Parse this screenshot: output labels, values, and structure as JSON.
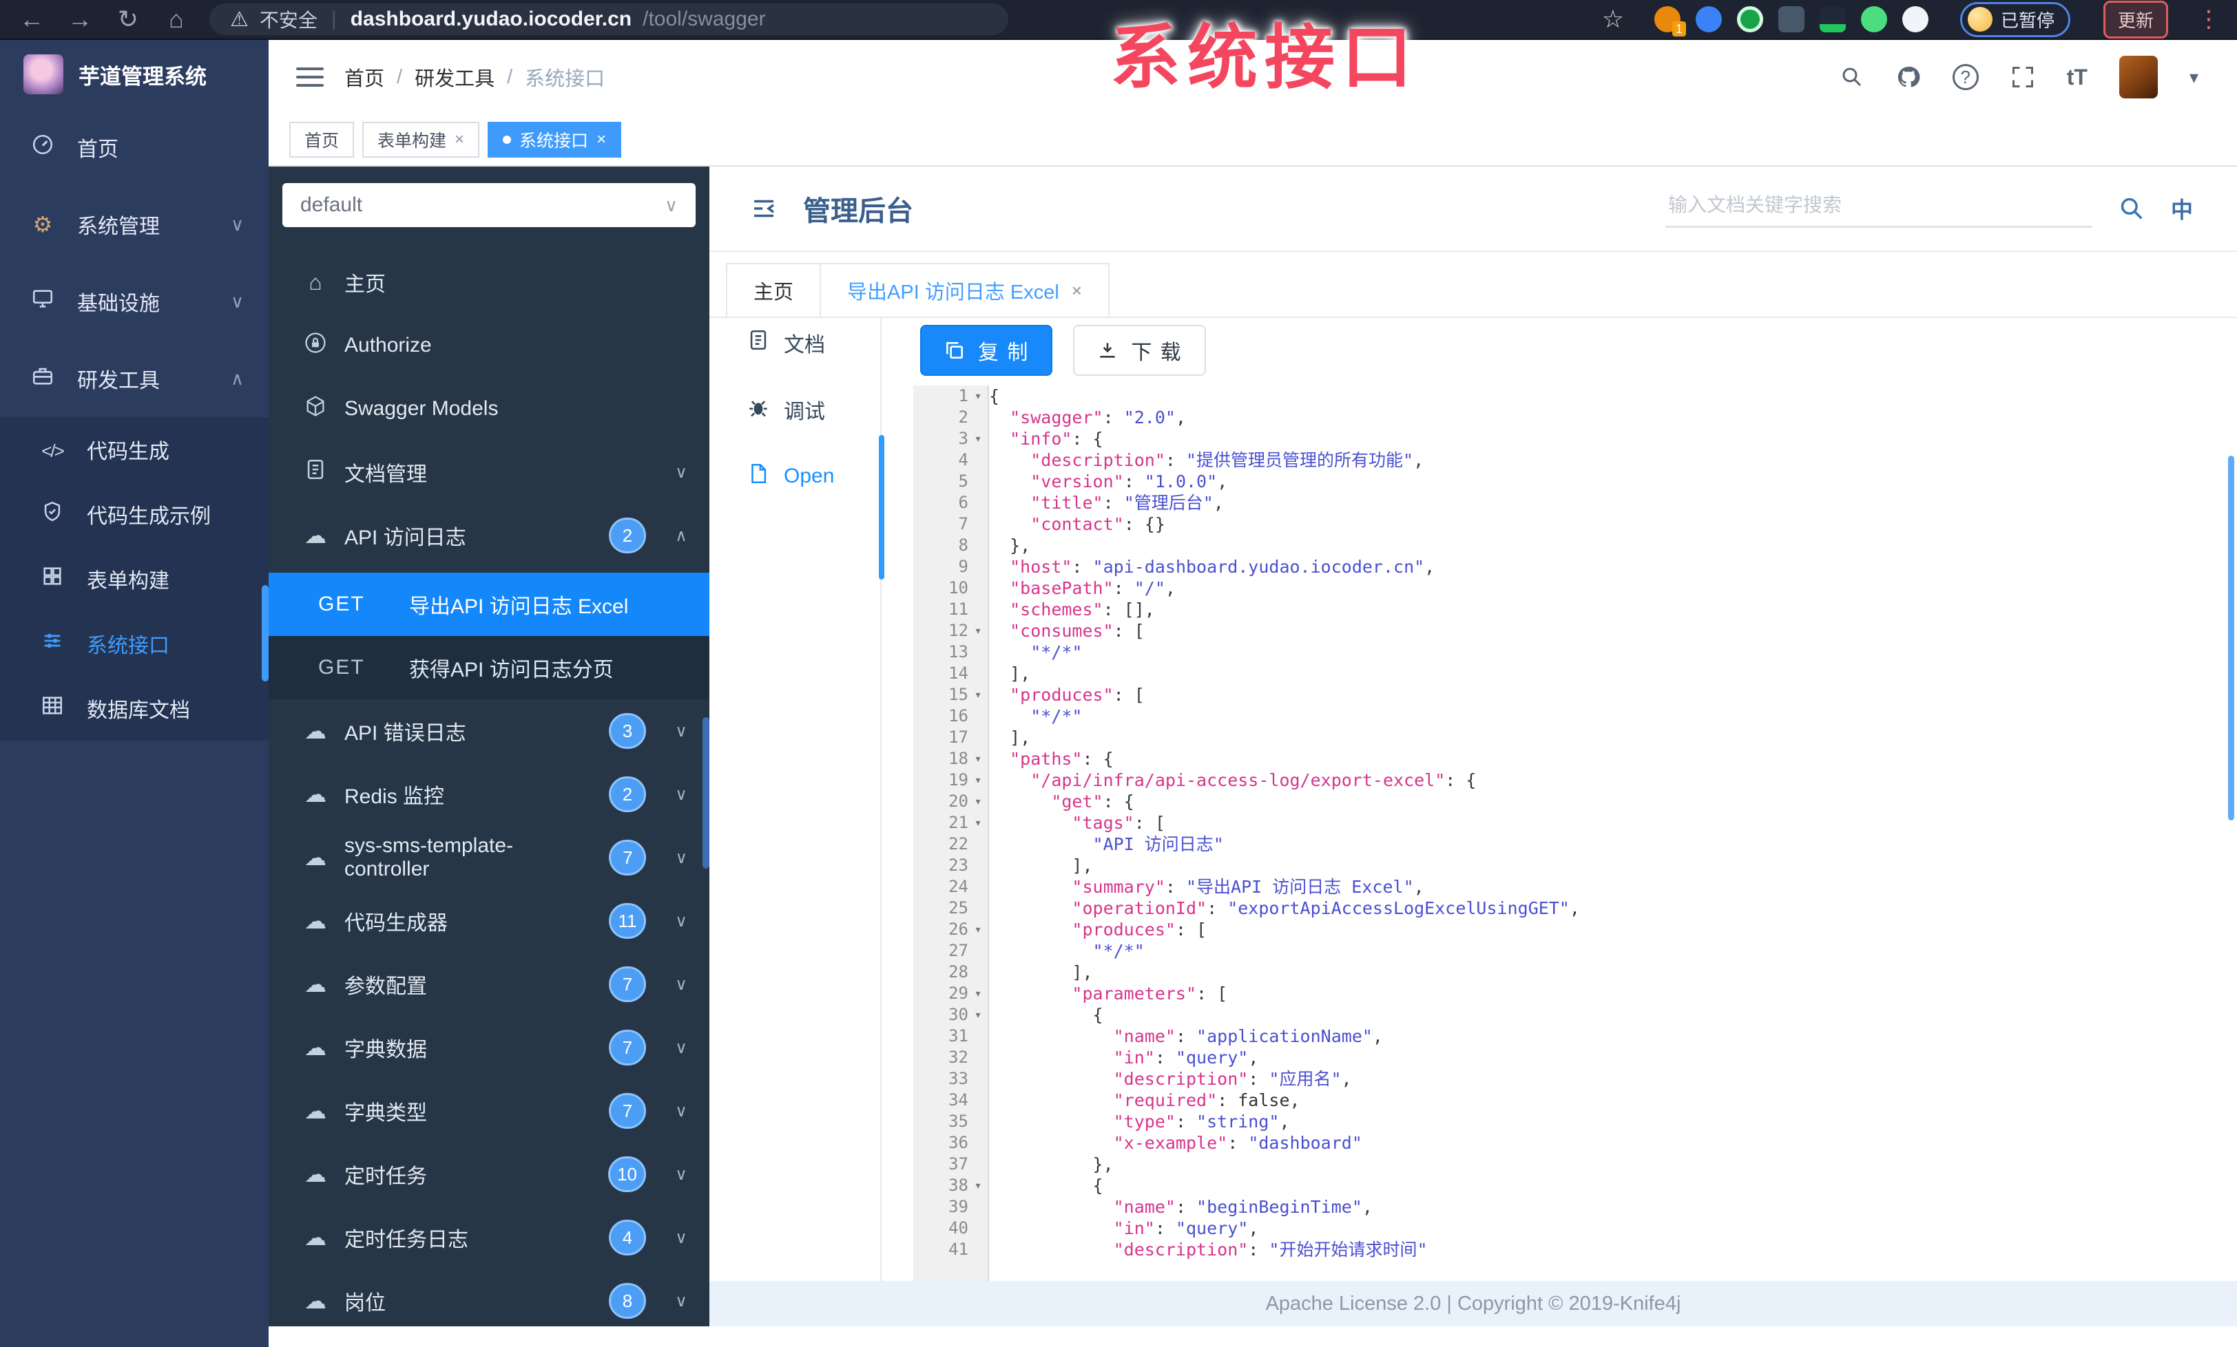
{
  "annotation": "系统接口",
  "browser": {
    "security": "不安全",
    "host": "dashboard.yudao.iocoder.cn",
    "path": "/tool/swagger",
    "ext_badge": "1",
    "paused": "已暂停",
    "update": "更新"
  },
  "app": {
    "title": "芋道管理系统"
  },
  "sidebar": {
    "main": [
      {
        "label": "首页",
        "icon": "gauge-icon",
        "chevron": ""
      },
      {
        "label": "系统管理",
        "icon": "gear-icon",
        "chevron": "down"
      },
      {
        "label": "基础设施",
        "icon": "infra-icon",
        "chevron": "down"
      },
      {
        "label": "研发工具",
        "icon": "tools-icon",
        "chevron": "up"
      }
    ],
    "sub": [
      {
        "label": "代码生成",
        "icon": "code-icon",
        "active": false
      },
      {
        "label": "代码生成示例",
        "icon": "shield-icon",
        "active": false
      },
      {
        "label": "表单构建",
        "icon": "form-icon",
        "active": false
      },
      {
        "label": "系统接口",
        "icon": "swagger-icon",
        "active": true
      },
      {
        "label": "数据库文档",
        "icon": "db-icon",
        "active": false
      }
    ]
  },
  "breadcrumb": [
    "首页",
    "研发工具",
    "系统接口"
  ],
  "tags": [
    {
      "label": "首页",
      "closable": false,
      "active": false
    },
    {
      "label": "表单构建",
      "closable": true,
      "active": false
    },
    {
      "label": "系统接口",
      "closable": true,
      "active": true
    }
  ],
  "swagger": {
    "group_select": "default",
    "menu": [
      {
        "label": "主页",
        "icon": "home-icon",
        "badge": "",
        "chevron": ""
      },
      {
        "label": "Authorize",
        "icon": "lock-icon",
        "badge": "",
        "chevron": ""
      },
      {
        "label": "Swagger Models",
        "icon": "cube-icon",
        "badge": "",
        "chevron": ""
      },
      {
        "label": "文档管理",
        "icon": "docs-icon",
        "badge": "",
        "chevron": "down"
      },
      {
        "label": "API 访问日志",
        "icon": "cloud-icon",
        "badge": "2",
        "chevron": "up"
      }
    ],
    "operations": [
      {
        "method": "GET",
        "label": "导出API 访问日志 Excel",
        "active": true
      },
      {
        "method": "GET",
        "label": "获得API 访问日志分页",
        "active": false
      }
    ],
    "groups": [
      {
        "label": "API 错误日志",
        "icon": "cloud-icon",
        "badge": "3"
      },
      {
        "label": "Redis 监控",
        "icon": "cloud-icon",
        "badge": "2"
      },
      {
        "label": "sys-sms-template-controller",
        "icon": "cloud-icon",
        "badge": "7"
      },
      {
        "label": "代码生成器",
        "icon": "cloud-icon",
        "badge": "11"
      },
      {
        "label": "参数配置",
        "icon": "cloud-icon",
        "badge": "7"
      },
      {
        "label": "字典数据",
        "icon": "cloud-icon",
        "badge": "7"
      },
      {
        "label": "字典类型",
        "icon": "cloud-icon",
        "badge": "7"
      },
      {
        "label": "定时任务",
        "icon": "cloud-icon",
        "badge": "10"
      },
      {
        "label": "定时任务日志",
        "icon": "cloud-icon",
        "badge": "4"
      },
      {
        "label": "岗位",
        "icon": "cloud-icon",
        "badge": "8"
      }
    ]
  },
  "k4": {
    "title": "管理后台",
    "search_placeholder": "输入文档关键字搜索",
    "tabs": [
      {
        "label": "主页",
        "closable": false,
        "active": false
      },
      {
        "label": "导出API 访问日志 Excel",
        "closable": true,
        "active": true
      }
    ],
    "doc_menu": [
      {
        "label": "文档",
        "icon": "doc-icon",
        "active": false
      },
      {
        "label": "调试",
        "icon": "debug-icon",
        "active": false
      },
      {
        "label": "Open",
        "icon": "file-icon",
        "active": true
      }
    ],
    "copy": "复 制",
    "download": "下 载",
    "footer": "Apache License 2.0 | Copyright © 2019-Knife4j"
  },
  "code": {
    "lines": [
      {
        "n": 1,
        "fold": true,
        "t": [
          [
            "p",
            "{"
          ]
        ]
      },
      {
        "n": 2,
        "fold": false,
        "t": [
          [
            "p",
            "  "
          ],
          [
            "k",
            "\"swagger\""
          ],
          [
            "p",
            ": "
          ],
          [
            "s",
            "\"2.0\""
          ],
          [
            "p",
            ","
          ]
        ]
      },
      {
        "n": 3,
        "fold": true,
        "t": [
          [
            "p",
            "  "
          ],
          [
            "k",
            "\"info\""
          ],
          [
            "p",
            ": {"
          ]
        ]
      },
      {
        "n": 4,
        "fold": false,
        "t": [
          [
            "p",
            "    "
          ],
          [
            "k",
            "\"description\""
          ],
          [
            "p",
            ": "
          ],
          [
            "s",
            "\"提供管理员管理的所有功能\""
          ],
          [
            "p",
            ","
          ]
        ]
      },
      {
        "n": 5,
        "fold": false,
        "t": [
          [
            "p",
            "    "
          ],
          [
            "k",
            "\"version\""
          ],
          [
            "p",
            ": "
          ],
          [
            "s",
            "\"1.0.0\""
          ],
          [
            "p",
            ","
          ]
        ]
      },
      {
        "n": 6,
        "fold": false,
        "t": [
          [
            "p",
            "    "
          ],
          [
            "k",
            "\"title\""
          ],
          [
            "p",
            ": "
          ],
          [
            "s",
            "\"管理后台\""
          ],
          [
            "p",
            ","
          ]
        ]
      },
      {
        "n": 7,
        "fold": false,
        "t": [
          [
            "p",
            "    "
          ],
          [
            "k",
            "\"contact\""
          ],
          [
            "p",
            ": {}"
          ]
        ]
      },
      {
        "n": 8,
        "fold": false,
        "t": [
          [
            "p",
            "  },"
          ]
        ]
      },
      {
        "n": 9,
        "fold": false,
        "t": [
          [
            "p",
            "  "
          ],
          [
            "k",
            "\"host\""
          ],
          [
            "p",
            ": "
          ],
          [
            "s",
            "\"api-dashboard.yudao.iocoder.cn\""
          ],
          [
            "p",
            ","
          ]
        ]
      },
      {
        "n": 10,
        "fold": false,
        "t": [
          [
            "p",
            "  "
          ],
          [
            "k",
            "\"basePath\""
          ],
          [
            "p",
            ": "
          ],
          [
            "s",
            "\"/\""
          ],
          [
            "p",
            ","
          ]
        ]
      },
      {
        "n": 11,
        "fold": false,
        "t": [
          [
            "p",
            "  "
          ],
          [
            "k",
            "\"schemes\""
          ],
          [
            "p",
            ": [],"
          ]
        ]
      },
      {
        "n": 12,
        "fold": true,
        "t": [
          [
            "p",
            "  "
          ],
          [
            "k",
            "\"consumes\""
          ],
          [
            "p",
            ": ["
          ]
        ]
      },
      {
        "n": 13,
        "fold": false,
        "t": [
          [
            "p",
            "    "
          ],
          [
            "s",
            "\"*/*\""
          ]
        ]
      },
      {
        "n": 14,
        "fold": false,
        "t": [
          [
            "p",
            "  ],"
          ]
        ]
      },
      {
        "n": 15,
        "fold": true,
        "t": [
          [
            "p",
            "  "
          ],
          [
            "k",
            "\"produces\""
          ],
          [
            "p",
            ": ["
          ]
        ]
      },
      {
        "n": 16,
        "fold": false,
        "t": [
          [
            "p",
            "    "
          ],
          [
            "s",
            "\"*/*\""
          ]
        ]
      },
      {
        "n": 17,
        "fold": false,
        "t": [
          [
            "p",
            "  ],"
          ]
        ]
      },
      {
        "n": 18,
        "fold": true,
        "t": [
          [
            "p",
            "  "
          ],
          [
            "k",
            "\"paths\""
          ],
          [
            "p",
            ": {"
          ]
        ]
      },
      {
        "n": 19,
        "fold": true,
        "t": [
          [
            "p",
            "    "
          ],
          [
            "k",
            "\"/api/infra/api-access-log/export-excel\""
          ],
          [
            "p",
            ": {"
          ]
        ]
      },
      {
        "n": 20,
        "fold": true,
        "t": [
          [
            "p",
            "      "
          ],
          [
            "k",
            "\"get\""
          ],
          [
            "p",
            ": {"
          ]
        ]
      },
      {
        "n": 21,
        "fold": true,
        "t": [
          [
            "p",
            "        "
          ],
          [
            "k",
            "\"tags\""
          ],
          [
            "p",
            ": ["
          ]
        ]
      },
      {
        "n": 22,
        "fold": false,
        "t": [
          [
            "p",
            "          "
          ],
          [
            "s",
            "\"API 访问日志\""
          ]
        ]
      },
      {
        "n": 23,
        "fold": false,
        "t": [
          [
            "p",
            "        ],"
          ]
        ]
      },
      {
        "n": 24,
        "fold": false,
        "t": [
          [
            "p",
            "        "
          ],
          [
            "k",
            "\"summary\""
          ],
          [
            "p",
            ": "
          ],
          [
            "s",
            "\"导出API 访问日志 Excel\""
          ],
          [
            "p",
            ","
          ]
        ]
      },
      {
        "n": 25,
        "fold": false,
        "t": [
          [
            "p",
            "        "
          ],
          [
            "k",
            "\"operationId\""
          ],
          [
            "p",
            ": "
          ],
          [
            "s",
            "\"exportApiAccessLogExcelUsingGET\""
          ],
          [
            "p",
            ","
          ]
        ]
      },
      {
        "n": 26,
        "fold": true,
        "t": [
          [
            "p",
            "        "
          ],
          [
            "k",
            "\"produces\""
          ],
          [
            "p",
            ": ["
          ]
        ]
      },
      {
        "n": 27,
        "fold": false,
        "t": [
          [
            "p",
            "          "
          ],
          [
            "s",
            "\"*/*\""
          ]
        ]
      },
      {
        "n": 28,
        "fold": false,
        "t": [
          [
            "p",
            "        ],"
          ]
        ]
      },
      {
        "n": 29,
        "fold": true,
        "t": [
          [
            "p",
            "        "
          ],
          [
            "k",
            "\"parameters\""
          ],
          [
            "p",
            ": ["
          ]
        ]
      },
      {
        "n": 30,
        "fold": true,
        "t": [
          [
            "p",
            "          {"
          ]
        ]
      },
      {
        "n": 31,
        "fold": false,
        "t": [
          [
            "p",
            "            "
          ],
          [
            "k",
            "\"name\""
          ],
          [
            "p",
            ": "
          ],
          [
            "s",
            "\"applicationName\""
          ],
          [
            "p",
            ","
          ]
        ]
      },
      {
        "n": 32,
        "fold": false,
        "t": [
          [
            "p",
            "            "
          ],
          [
            "k",
            "\"in\""
          ],
          [
            "p",
            ": "
          ],
          [
            "s",
            "\"query\""
          ],
          [
            "p",
            ","
          ]
        ]
      },
      {
        "n": 33,
        "fold": false,
        "t": [
          [
            "p",
            "            "
          ],
          [
            "k",
            "\"description\""
          ],
          [
            "p",
            ": "
          ],
          [
            "s",
            "\"应用名\""
          ],
          [
            "p",
            ","
          ]
        ]
      },
      {
        "n": 34,
        "fold": false,
        "t": [
          [
            "p",
            "            "
          ],
          [
            "k",
            "\"required\""
          ],
          [
            "p",
            ": "
          ],
          [
            "b",
            "false"
          ],
          [
            "p",
            ","
          ]
        ]
      },
      {
        "n": 35,
        "fold": false,
        "t": [
          [
            "p",
            "            "
          ],
          [
            "k",
            "\"type\""
          ],
          [
            "p",
            ": "
          ],
          [
            "s",
            "\"string\""
          ],
          [
            "p",
            ","
          ]
        ]
      },
      {
        "n": 36,
        "fold": false,
        "t": [
          [
            "p",
            "            "
          ],
          [
            "k",
            "\"x-example\""
          ],
          [
            "p",
            ": "
          ],
          [
            "s",
            "\"dashboard\""
          ]
        ]
      },
      {
        "n": 37,
        "fold": false,
        "t": [
          [
            "p",
            "          },"
          ]
        ]
      },
      {
        "n": 38,
        "fold": true,
        "t": [
          [
            "p",
            "          {"
          ]
        ]
      },
      {
        "n": 39,
        "fold": false,
        "t": [
          [
            "p",
            "            "
          ],
          [
            "k",
            "\"name\""
          ],
          [
            "p",
            ": "
          ],
          [
            "s",
            "\"beginBeginTime\""
          ],
          [
            "p",
            ","
          ]
        ]
      },
      {
        "n": 40,
        "fold": false,
        "t": [
          [
            "p",
            "            "
          ],
          [
            "k",
            "\"in\""
          ],
          [
            "p",
            ": "
          ],
          [
            "s",
            "\"query\""
          ],
          [
            "p",
            ","
          ]
        ]
      },
      {
        "n": 41,
        "fold": false,
        "t": [
          [
            "p",
            "            "
          ],
          [
            "k",
            "\"description\""
          ],
          [
            "p",
            ": "
          ],
          [
            "s",
            "\"开始开始请求时间\""
          ]
        ]
      }
    ]
  }
}
